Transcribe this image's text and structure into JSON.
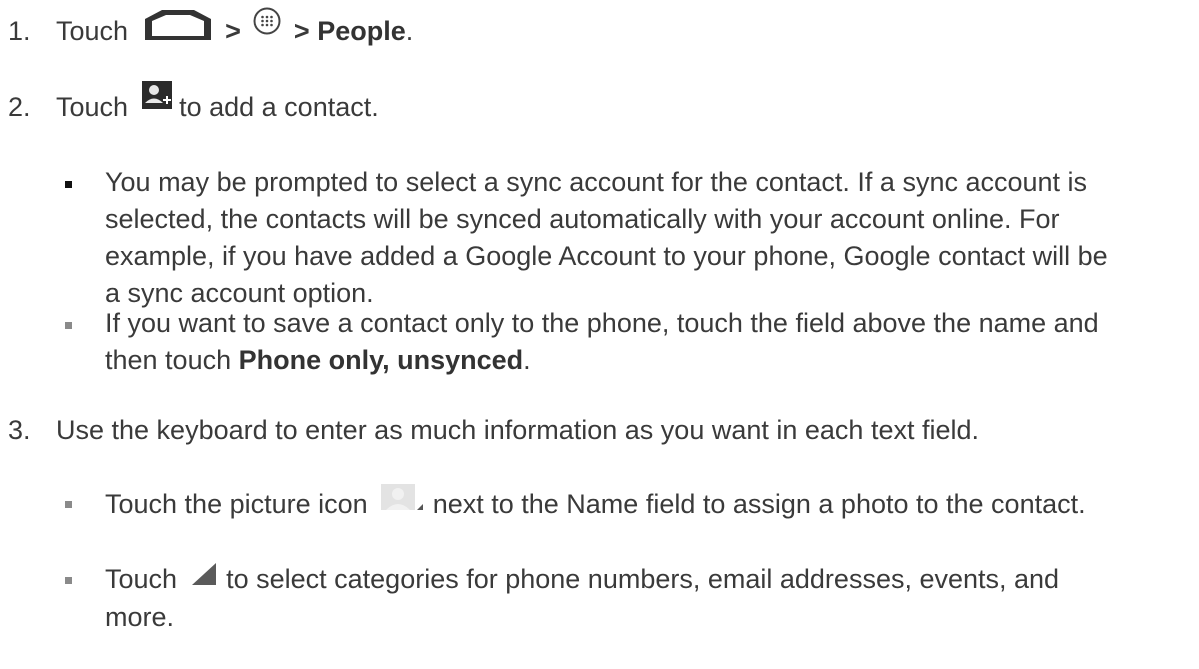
{
  "steps": [
    {
      "number": "1.",
      "text_before": "Touch",
      "sep1": ">",
      "sep2": ">",
      "bold": "People",
      "end": ".",
      "icons": [
        "home-icon",
        "apps-icon"
      ]
    },
    {
      "number": "2.",
      "text_before": "Touch",
      "text_after": "to add a contact.",
      "icons": [
        "add-contact-icon"
      ]
    },
    {
      "number": "3.",
      "text": "Use the keyboard to enter as much information as you want in each text field."
    }
  ],
  "step2_bullets": [
    {
      "lines": [
        "You may be prompted to select a sync account for the contact. If a sync account is",
        "selected, the contacts will be synced automatically with your account online. For",
        "example, if you have added a Google Account to your phone, Google contact will be",
        "a sync account option."
      ]
    },
    {
      "line1": "If you want to save a contact only to the phone, touch the field above the name and",
      "line2_before": "then touch",
      "line2_bold": "Phone only, unsynced",
      "line2_end": "."
    }
  ],
  "step3_bullets": [
    {
      "before": "Touch the picture icon",
      "after": "next to the Name field to assign a photo to the contact.",
      "icon": "picture-icon"
    },
    {
      "before": "Touch",
      "after": "to select categories for phone numbers, email addresses, events, and",
      "line2": "more.",
      "icon": "triangle-icon"
    }
  ]
}
